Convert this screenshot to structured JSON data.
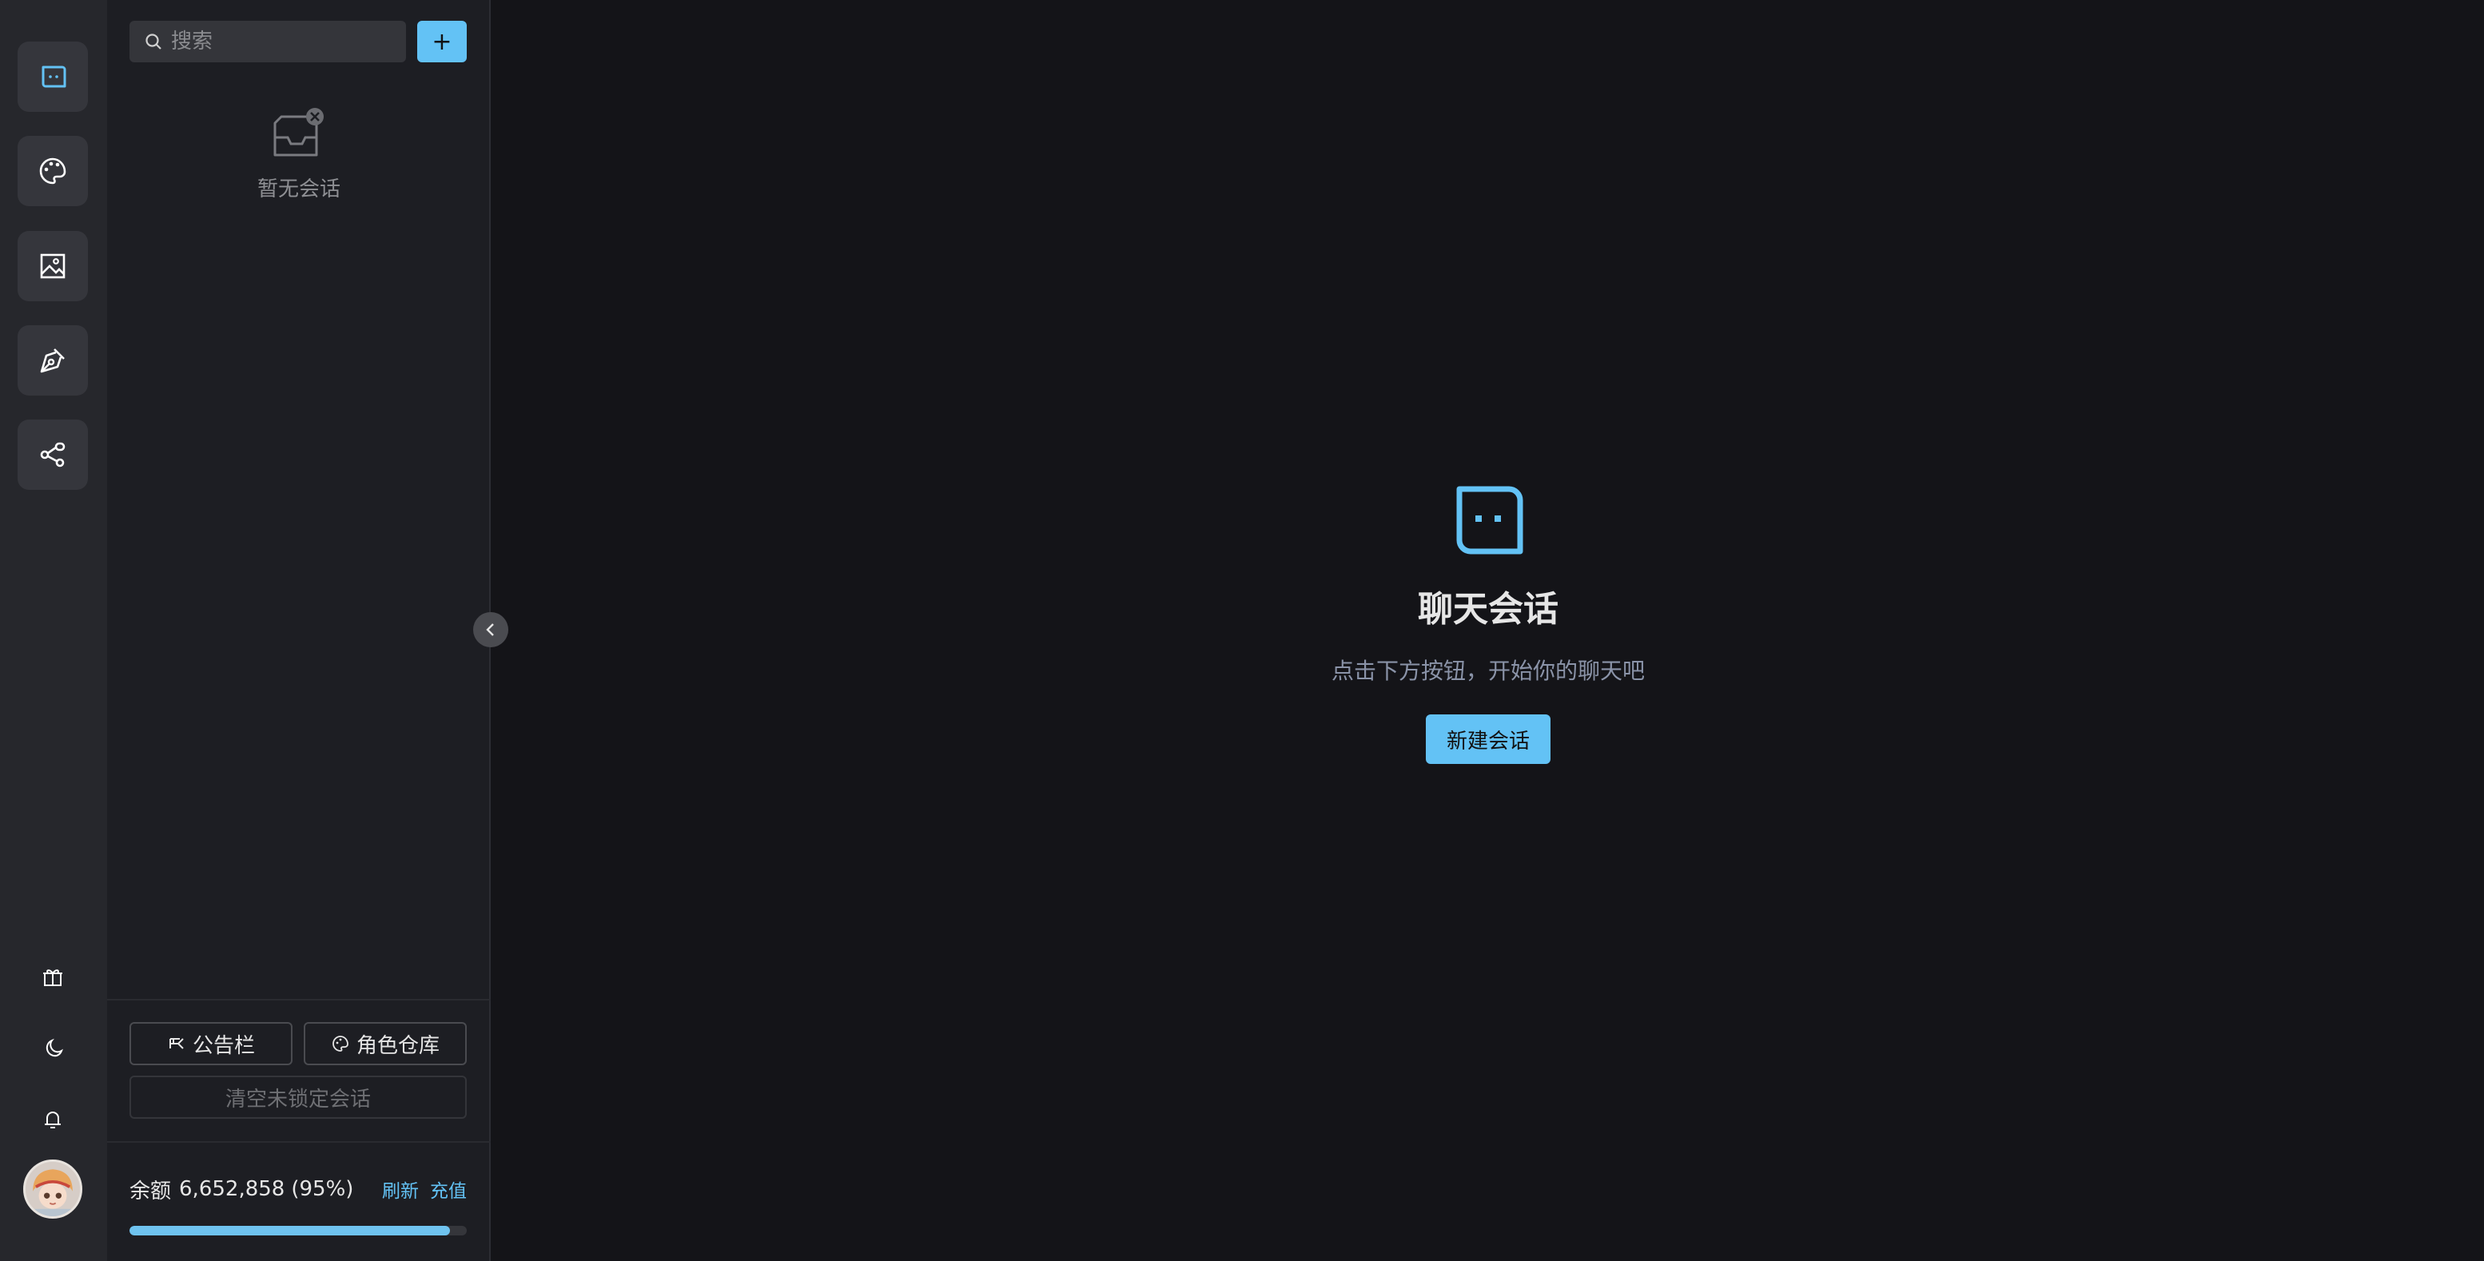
{
  "rail": {
    "items": [
      {
        "icon": "chat-bubble-icon",
        "active": true
      },
      {
        "icon": "palette-icon"
      },
      {
        "icon": "image-icon"
      },
      {
        "icon": "pen-tool-icon"
      },
      {
        "icon": "share-nodes-icon"
      }
    ],
    "bottom": [
      {
        "icon": "gift-icon"
      },
      {
        "icon": "moon-icon"
      },
      {
        "icon": "bell-icon"
      }
    ],
    "avatar": "avatar"
  },
  "sidebar": {
    "search_placeholder": "搜索",
    "add_label": "+",
    "empty_text": "暂无会话",
    "notice_label": "公告栏",
    "roles_label": "角色仓库",
    "clear_label": "清空未锁定会话",
    "balance_label": "余额",
    "balance_value": "6,652,858",
    "balance_pct": "(95%)",
    "balance_fraction": 0.95,
    "refresh_label": "刷新",
    "recharge_label": "充值"
  },
  "main": {
    "title": "聊天会话",
    "subtitle": "点击下方按钮，开始你的聊天吧",
    "new_chat_label": "新建会话"
  },
  "colors": {
    "accent": "#63c2f5",
    "rail_bg": "#26272c",
    "sidebar_bg": "#1d1e23",
    "main_bg": "#141418"
  }
}
